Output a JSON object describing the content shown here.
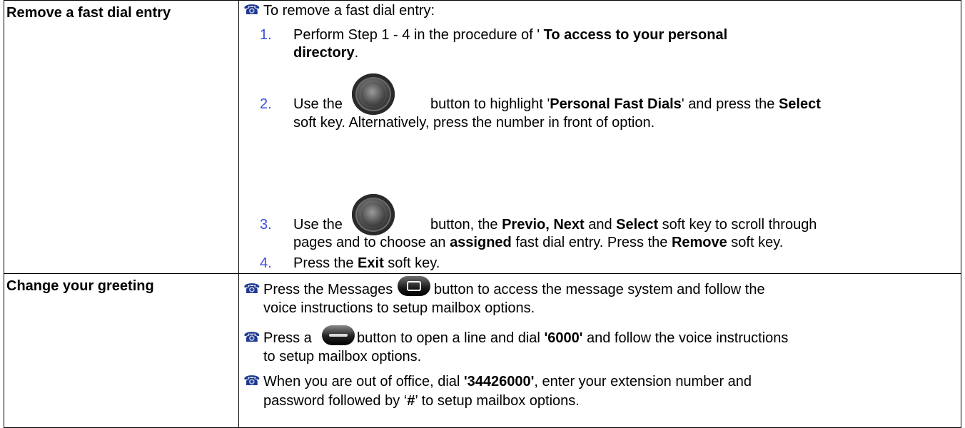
{
  "rows": [
    {
      "label": "Remove a fast dial entry",
      "intro": "To remove a fast dial entry:",
      "steps": [
        {
          "num": "1.",
          "l1_a": "Perform Step 1 - 4 in the procedure of ' ",
          "l1_b": "To access to your personal",
          "l2_b": "directory",
          "l2_c": "."
        },
        {
          "num": "2.",
          "l1_a": "Use the",
          "l1_b": "button to highlight '",
          "l1_c": "Personal Fast Dials",
          "l1_d": "' and press the ",
          "l1_e": "Select",
          "l2_a": "soft key.  Alternatively, press the number in front of option."
        },
        {
          "num": "3.",
          "l1_a": "Use the",
          "l1_b": "button, the ",
          "l1_c": "Previo, Next",
          "l1_d": " and ",
          "l1_e": "Select",
          "l1_f": " soft key to scroll through",
          "l2_a": "pages and to choose an ",
          "l2_b": "assigned",
          "l2_c": " fast dial entry. Press the ",
          "l2_d": "Remove",
          "l2_e": " soft key."
        },
        {
          "num": "4.",
          "l1_a": "Press the ",
          "l1_b": "Exit",
          "l1_c": " soft key."
        }
      ]
    },
    {
      "label": "Change your greeting",
      "bullets": [
        {
          "l1_a": "Press the Messages",
          "l1_b": "button to access the message system and follow the",
          "l2_a": "voice instructions to setup mailbox options."
        },
        {
          "l1_a": "Press a",
          "l1_b": "button to open a line and dial ",
          "l1_c": "'6000'",
          "l1_d": " and follow the voice instructions",
          "l2_a": "to setup mailbox options."
        },
        {
          "l1_a": "When you are out of office, dial ",
          "l1_b": "'34426000'",
          "l1_c": ", enter your extension number and",
          "l2_a": "password followed by ‘",
          "l2_b": "#",
          "l2_c": "’ to setup mailbox options."
        }
      ]
    }
  ],
  "icons": {
    "bullet": "telephone-icon",
    "nav": "navigation-button-icon",
    "messages": "messages-button-icon",
    "line": "line-button-icon"
  },
  "glyphs": {
    "bullet": "☎"
  },
  "colors": {
    "number": "#3a4bdc",
    "bullet": "#1f3a93",
    "border": "#000000"
  }
}
